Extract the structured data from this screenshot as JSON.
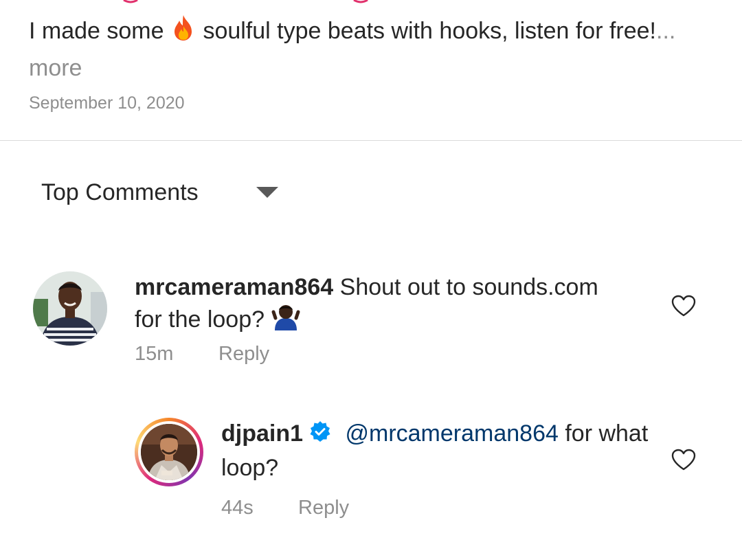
{
  "post": {
    "caption_start": "I made some",
    "caption_end": "soulful type beats with hooks, listen for free!",
    "more_label": "... more",
    "date": "September 10, 2020"
  },
  "comments_header": {
    "sort_label": "Top Comments"
  },
  "comments": [
    {
      "username": "mrcameraman864",
      "text": "Shout out to sounds.com for the loop?",
      "time": "15m",
      "reply_label": "Reply"
    },
    {
      "username": "djpain1",
      "mention": "@mrcameraman864",
      "text": "for what loop?",
      "time": "44s",
      "reply_label": "Reply"
    }
  ],
  "icons": [
    "fire-emoji",
    "shrug-emoji",
    "verified-badge-icon",
    "heart-icon",
    "chevron-down-icon"
  ],
  "colors": {
    "text": "#262626",
    "muted": "#8e8e8e",
    "mention": "#00376b",
    "verified": "#0095f6",
    "divider": "#dbdbdb"
  }
}
